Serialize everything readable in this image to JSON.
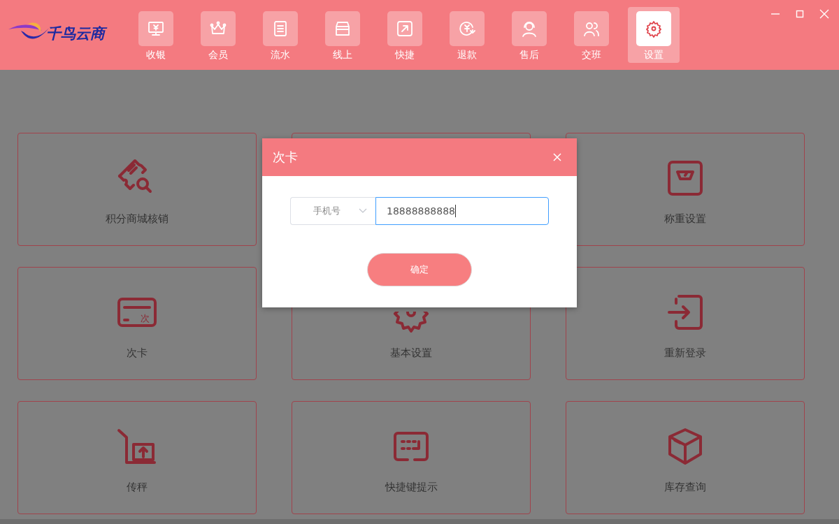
{
  "app": {
    "logo_text": "千鸟云商"
  },
  "nav": [
    {
      "label": "收银",
      "selected": false
    },
    {
      "label": "会员",
      "selected": false
    },
    {
      "label": "流水",
      "selected": false
    },
    {
      "label": "线上",
      "selected": false
    },
    {
      "label": "快捷",
      "selected": false
    },
    {
      "label": "退款",
      "selected": false
    },
    {
      "label": "售后",
      "selected": false
    },
    {
      "label": "交班",
      "selected": false
    },
    {
      "label": "设置",
      "selected": true
    }
  ],
  "cards": [
    {
      "kind": "menu",
      "label": "积分商城核销"
    },
    {
      "kind": "covered"
    },
    {
      "kind": "menu",
      "label": "称重设置"
    },
    {
      "kind": "menu",
      "label": "次卡",
      "icon_text": "次"
    },
    {
      "kind": "menu",
      "label": "基本设置"
    },
    {
      "kind": "menu",
      "label": "重新登录"
    },
    {
      "kind": "menu",
      "label": "传秤"
    },
    {
      "kind": "menu",
      "label": "快捷键提示"
    },
    {
      "kind": "menu",
      "label": "库存查询"
    }
  ],
  "dialog": {
    "title": "次卡",
    "select_value": "手机号",
    "input_value": "18888888888",
    "confirm": "确定"
  }
}
